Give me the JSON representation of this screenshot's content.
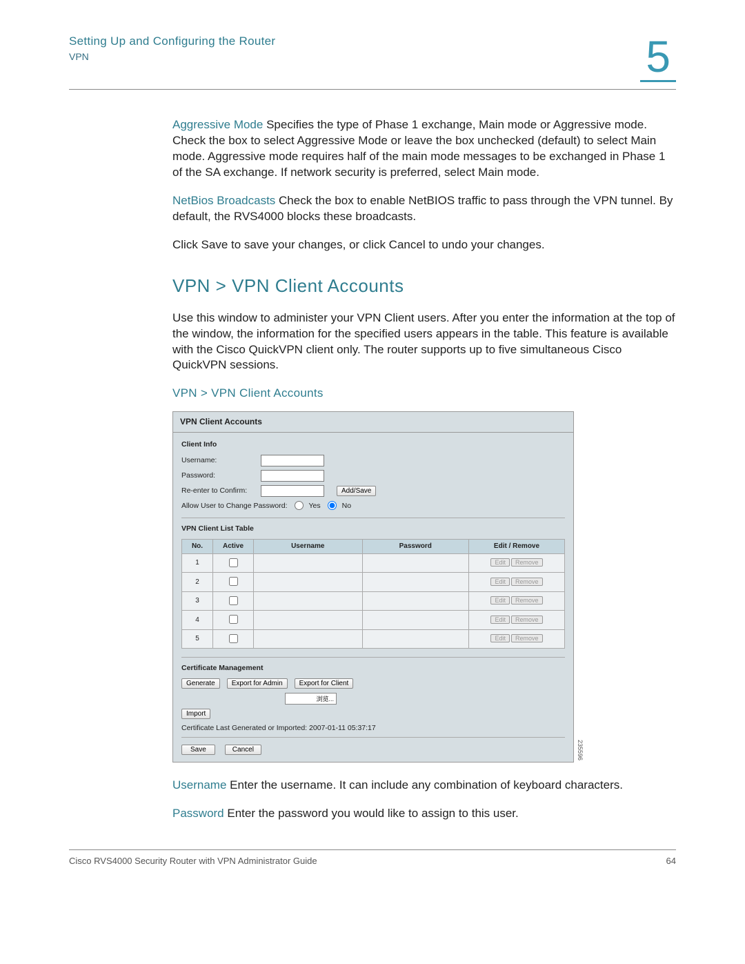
{
  "header": {
    "title": "Setting Up and Configuring the Router",
    "subtitle": "VPN",
    "chapter": "5"
  },
  "body": {
    "aggressive_term": "Aggressive Mode",
    "aggressive_text": " Specifies the type of Phase 1 exchange, Main mode or Aggressive mode. Check the box to select Aggressive Mode or leave the box unchecked (default) to select Main mode. Aggressive mode requires half of the main mode messages to be exchanged in Phase 1 of the SA exchange. If network security is preferred, select Main mode.",
    "netbios_term": "NetBios Broadcasts",
    "netbios_text": " Check the box to enable NetBIOS traffic to pass through the VPN tunnel. By default, the RVS4000 blocks these broadcasts.",
    "save_note": "Click Save to save your changes, or click Cancel to undo your changes.",
    "section_heading": "VPN > VPN Client Accounts",
    "section_intro": "Use this window to administer your VPN Client users. After you enter the information at the top of the window, the information for the specified users appears in the table. This feature is available with the Cisco QuickVPN client only. The router supports up to five simultaneous Cisco QuickVPN sessions.",
    "subsection_heading": "VPN > VPN Client Accounts",
    "username_term": "Username",
    "username_text": " Enter the username. It can include any combination of keyboard characters.",
    "password_term": "Password",
    "password_text": " Enter the password you would like to assign to this user."
  },
  "panel": {
    "title": "VPN Client Accounts",
    "client_info": "Client Info",
    "lbl_username": "Username:",
    "lbl_password": "Password:",
    "lbl_reenter": "Re-enter to Confirm:",
    "btn_addsave": "Add/Save",
    "allow_label": "Allow User to Change Password:",
    "yes": "Yes",
    "no": "No",
    "list_heading": "VPN Client List Table",
    "cols": {
      "no": "No.",
      "active": "Active",
      "username": "Username",
      "password": "Password",
      "edit": "Edit / Remove"
    },
    "rows": [
      "1",
      "2",
      "3",
      "4",
      "5"
    ],
    "btn_edit": "Edit",
    "btn_remove": "Remove",
    "cert_heading": "Certificate Management",
    "btn_generate": "Generate",
    "btn_export_admin": "Export for Admin",
    "btn_export_client": "Export for Client",
    "file_label": "浏览...",
    "btn_import": "Import",
    "cert_last_label": "Certificate Last Generated or Imported:",
    "cert_last_value": "2007-01-11 05:37:17",
    "btn_save": "Save",
    "btn_cancel": "Cancel",
    "figure_id": "235596"
  },
  "footer": {
    "left": "Cisco RVS4000 Security Router with VPN Administrator Guide",
    "page": "64"
  }
}
